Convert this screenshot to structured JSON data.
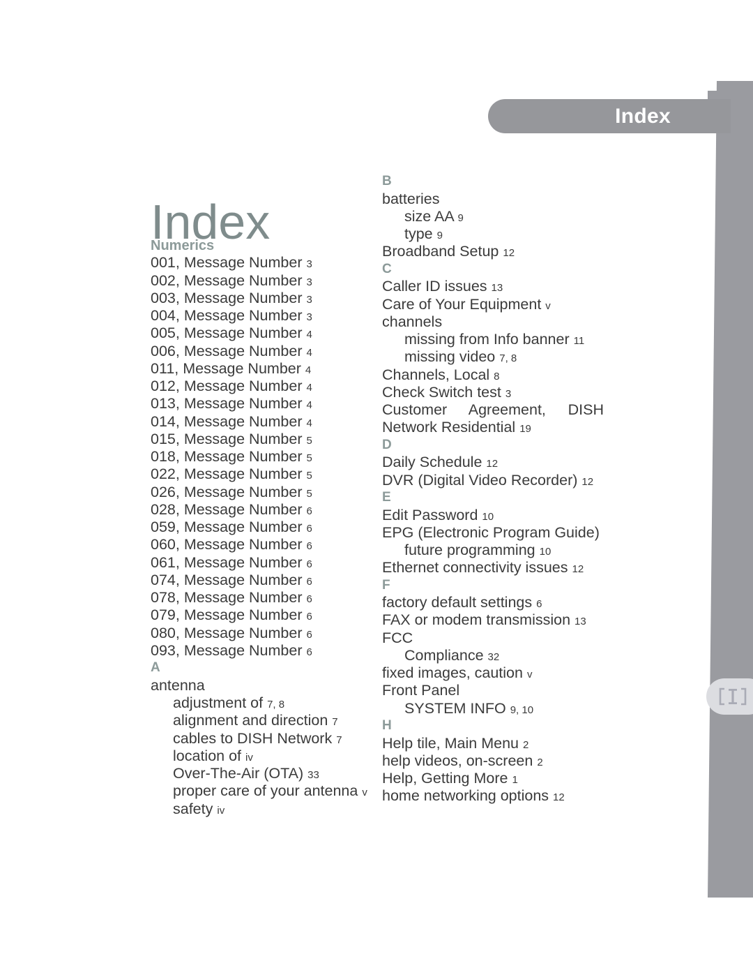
{
  "header": {
    "tab_label": "Index",
    "tab_color": "#96979b",
    "tab_text_color": "#ffffff"
  },
  "side_tab": {
    "icon": "bracket-ibeam-icon",
    "bg_color": "#dcdde1",
    "icon_color": "#a9abb5"
  },
  "page": {
    "title": "Index",
    "title_color": "#7f8c8c",
    "background": "#ffffff",
    "text_color": "#3b3b3b",
    "heading_color": "#8c9a99",
    "band_color": "#9a9ba0"
  },
  "columns": {
    "left": [
      {
        "kind": "section",
        "label": "Numerics"
      },
      {
        "kind": "entry",
        "level": 0,
        "text": "001, Message Number",
        "pages": "3"
      },
      {
        "kind": "entry",
        "level": 0,
        "text": "002, Message Number",
        "pages": "3"
      },
      {
        "kind": "entry",
        "level": 0,
        "text": "003, Message Number",
        "pages": "3"
      },
      {
        "kind": "entry",
        "level": 0,
        "text": "004, Message Number",
        "pages": "3"
      },
      {
        "kind": "entry",
        "level": 0,
        "text": "005, Message Number",
        "pages": "4"
      },
      {
        "kind": "entry",
        "level": 0,
        "text": "006, Message Number",
        "pages": "4"
      },
      {
        "kind": "entry",
        "level": 0,
        "text": "011, Message Number",
        "pages": "4"
      },
      {
        "kind": "entry",
        "level": 0,
        "text": "012, Message Number",
        "pages": "4"
      },
      {
        "kind": "entry",
        "level": 0,
        "text": "013, Message Number",
        "pages": "4"
      },
      {
        "kind": "entry",
        "level": 0,
        "text": "014, Message Number",
        "pages": "4"
      },
      {
        "kind": "entry",
        "level": 0,
        "text": "015, Message Number",
        "pages": "5"
      },
      {
        "kind": "entry",
        "level": 0,
        "text": "018, Message Number",
        "pages": "5"
      },
      {
        "kind": "entry",
        "level": 0,
        "text": "022, Message Number",
        "pages": "5"
      },
      {
        "kind": "entry",
        "level": 0,
        "text": "026, Message Number",
        "pages": "5"
      },
      {
        "kind": "entry",
        "level": 0,
        "text": "028, Message Number",
        "pages": "6"
      },
      {
        "kind": "entry",
        "level": 0,
        "text": "059, Message Number",
        "pages": "6"
      },
      {
        "kind": "entry",
        "level": 0,
        "text": "060, Message Number",
        "pages": "6"
      },
      {
        "kind": "entry",
        "level": 0,
        "text": "061, Message Number",
        "pages": "6"
      },
      {
        "kind": "entry",
        "level": 0,
        "text": "074, Message Number",
        "pages": "6"
      },
      {
        "kind": "entry",
        "level": 0,
        "text": "078, Message Number",
        "pages": "6"
      },
      {
        "kind": "entry",
        "level": 0,
        "text": "079, Message Number",
        "pages": "6"
      },
      {
        "kind": "entry",
        "level": 0,
        "text": "080, Message Number",
        "pages": "6"
      },
      {
        "kind": "entry",
        "level": 0,
        "text": "093, Message Number",
        "pages": "6"
      },
      {
        "kind": "letter",
        "label": "A"
      },
      {
        "kind": "entry",
        "level": 0,
        "text": "antenna",
        "pages": ""
      },
      {
        "kind": "entry",
        "level": 1,
        "text": "adjustment of",
        "pages": "7, 8"
      },
      {
        "kind": "entry",
        "level": 1,
        "text": "alignment and direction",
        "pages": "7"
      },
      {
        "kind": "entry",
        "level": 1,
        "text": "cables to DISH Network",
        "pages": "7"
      },
      {
        "kind": "entry",
        "level": 1,
        "text": "location of",
        "pages": "iv"
      },
      {
        "kind": "entry",
        "level": 1,
        "text": "Over-The-Air (OTA)",
        "pages": "33"
      },
      {
        "kind": "entry",
        "level": 1,
        "text": "proper care of your antenna",
        "pages": "v"
      },
      {
        "kind": "entry",
        "level": 1,
        "text": "safety",
        "pages": "iv"
      }
    ],
    "right": [
      {
        "kind": "letter",
        "label": "B"
      },
      {
        "kind": "entry",
        "level": 0,
        "text": "batteries",
        "pages": ""
      },
      {
        "kind": "entry",
        "level": 1,
        "text": "size AA",
        "pages": "9"
      },
      {
        "kind": "entry",
        "level": 1,
        "text": "type",
        "pages": "9"
      },
      {
        "kind": "entry",
        "level": 0,
        "text": "Broadband Setup",
        "pages": "12"
      },
      {
        "kind": "letter",
        "label": "C"
      },
      {
        "kind": "entry",
        "level": 0,
        "text": "Caller ID issues",
        "pages": "13"
      },
      {
        "kind": "entry",
        "level": 0,
        "text": "Care of Your Equipment",
        "pages": "v"
      },
      {
        "kind": "entry",
        "level": 0,
        "text": "channels",
        "pages": ""
      },
      {
        "kind": "entry",
        "level": 1,
        "text": "missing from Info banner",
        "pages": "11"
      },
      {
        "kind": "entry",
        "level": 1,
        "text": "missing video",
        "pages": "7, 8"
      },
      {
        "kind": "entry",
        "level": 0,
        "text": "Channels, Local",
        "pages": "8"
      },
      {
        "kind": "entry",
        "level": 0,
        "text": "Check Switch test",
        "pages": "3"
      },
      {
        "kind": "entry",
        "level": 0,
        "justify": true,
        "text": "Customer Agreement, DISH Network Residential",
        "pages": "19"
      },
      {
        "kind": "letter",
        "label": "D"
      },
      {
        "kind": "entry",
        "level": 0,
        "text": "Daily Schedule",
        "pages": "12"
      },
      {
        "kind": "entry",
        "level": 0,
        "text": "DVR (Digital Video Recorder)",
        "pages": "12"
      },
      {
        "kind": "letter",
        "label": "E"
      },
      {
        "kind": "entry",
        "level": 0,
        "text": "Edit Password",
        "pages": "10"
      },
      {
        "kind": "entry",
        "level": 0,
        "justify": true,
        "text": "EPG (Electronic Program Guide)",
        "pages": ""
      },
      {
        "kind": "entry",
        "level": 1,
        "text": "future programming",
        "pages": "10"
      },
      {
        "kind": "entry",
        "level": 0,
        "text": "Ethernet connectivity issues",
        "pages": "12"
      },
      {
        "kind": "letter",
        "label": "F"
      },
      {
        "kind": "entry",
        "level": 0,
        "text": "factory default settings",
        "pages": "6"
      },
      {
        "kind": "entry",
        "level": 0,
        "text": "FAX or modem transmission",
        "pages": "13"
      },
      {
        "kind": "entry",
        "level": 0,
        "text": "FCC",
        "pages": ""
      },
      {
        "kind": "entry",
        "level": 1,
        "text": "Compliance",
        "pages": "32"
      },
      {
        "kind": "entry",
        "level": 0,
        "text": "fixed images, caution",
        "pages": "v"
      },
      {
        "kind": "entry",
        "level": 0,
        "text": "Front Panel",
        "pages": ""
      },
      {
        "kind": "entry",
        "level": 1,
        "text": "SYSTEM INFO",
        "pages": "9, 10"
      },
      {
        "kind": "letter",
        "label": "H"
      },
      {
        "kind": "entry",
        "level": 0,
        "text": "Help tile, Main Menu",
        "pages": "2"
      },
      {
        "kind": "entry",
        "level": 0,
        "text": "help videos, on-screen",
        "pages": "2"
      },
      {
        "kind": "entry",
        "level": 0,
        "text": "Help, Getting More",
        "pages": "1"
      },
      {
        "kind": "entry",
        "level": 0,
        "text": "home networking options",
        "pages": "12"
      }
    ]
  }
}
